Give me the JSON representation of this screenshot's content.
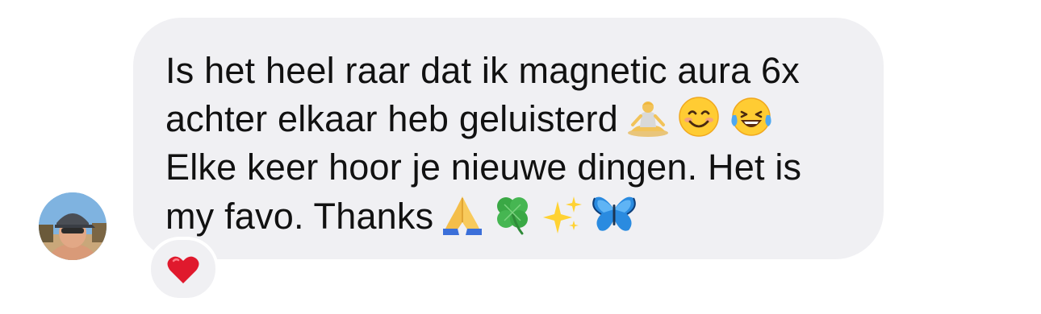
{
  "message": {
    "lines": [
      "Is het heel raar dat ik magnetic aura 6x",
      "achter elkaar heb geluisterd",
      "Elke keer hoor je nieuwe dingen. Het is",
      "my favo. Thanks"
    ],
    "line2_emojis": [
      "person-in-lotus-position-icon",
      "smiling-face-icon",
      "tears-of-joy-icon"
    ],
    "line4_emojis": [
      "folded-hands-icon",
      "four-leaf-clover-icon",
      "sparkles-icon",
      "butterfly-icon"
    ]
  },
  "reaction": {
    "emoji": "red-heart-icon"
  },
  "sender": {
    "avatar": "avatar"
  },
  "colors": {
    "bubble": "#f0f0f3",
    "text": "#111111",
    "heart": "#e0192d"
  }
}
